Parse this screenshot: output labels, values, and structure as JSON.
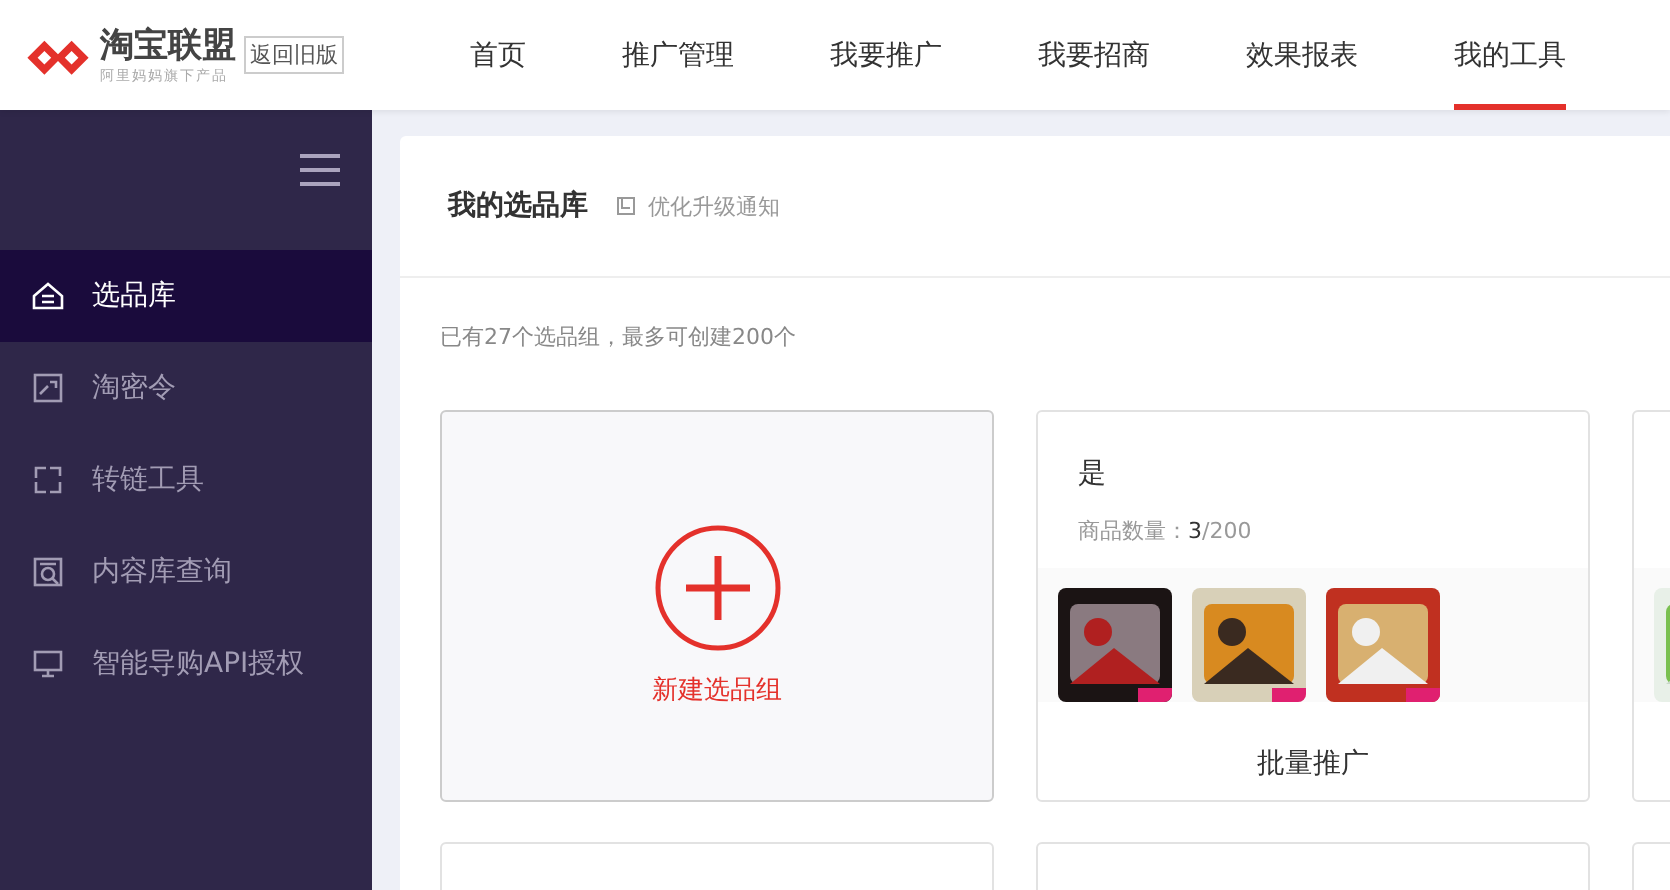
{
  "header": {
    "logo": "淘宝联盟",
    "logo_sub": "阿里妈妈旗下产品",
    "old_version": "返回旧版",
    "tabs": [
      {
        "label": "首页",
        "selected": false
      },
      {
        "label": "推广管理",
        "selected": false
      },
      {
        "label": "我要推广",
        "selected": false
      },
      {
        "label": "我要招商",
        "selected": false
      },
      {
        "label": "效果报表",
        "selected": false
      },
      {
        "label": "我的工具",
        "selected": true
      }
    ]
  },
  "sidebar": {
    "items": [
      {
        "label": "选品库",
        "selected": true,
        "kind": "home"
      },
      {
        "label": "淘密令",
        "selected": false,
        "kind": "code"
      },
      {
        "label": "转链工具",
        "selected": false,
        "kind": "link"
      },
      {
        "label": "内容库查询",
        "selected": false,
        "kind": "search"
      },
      {
        "label": "智能导购API授权",
        "selected": false,
        "kind": "api"
      }
    ]
  },
  "panel": {
    "title": "我的选品库",
    "notice": "优化升级通知",
    "summary": "已有27个选品组，最多可创建200个",
    "cards": [
      {
        "kind": "new",
        "label": "新建选品组"
      },
      {
        "kind": "group",
        "name": "是",
        "count": "商品数量：**3**/200",
        "button": "批量推广"
      },
      {
        "kind": "partial"
      },
      {
        "kind": "blank"
      },
      {
        "kind": "blank"
      },
      {
        "kind": "blank"
      }
    ]
  }
}
